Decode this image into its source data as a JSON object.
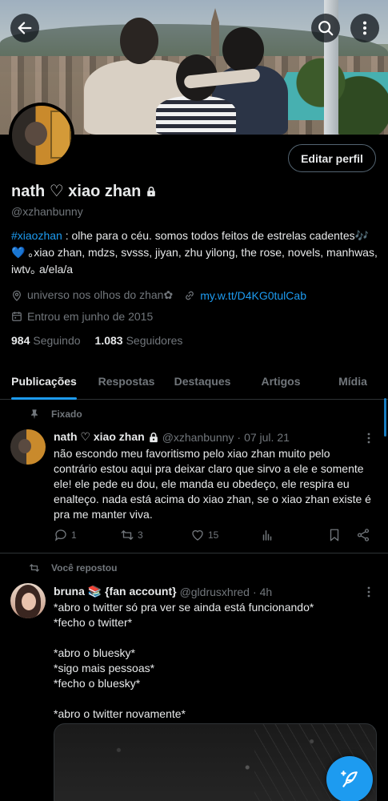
{
  "header": {
    "back_icon": "arrow-left-icon",
    "search_icon": "search-icon",
    "more_icon": "more-vertical-icon"
  },
  "profile": {
    "display_name": "nath ♡ xiao zhan",
    "handle": "@xzhanbunny",
    "edit_button": "Editar perfil",
    "bio_hashtag": "#xiaozhan",
    "bio_text": " : olhe para o céu. somos todos feitos de estrelas cadentes🎶💙 ｡xiao zhan, mdzs, svsss, jiyan, zhu yilong, the rose, novels, manhwas, iwtv｡ a/ela/a",
    "location": "universo nos olhos do zhan✿",
    "link": "my.w.tt/D4KG0tulCab",
    "joined": "Entrou em junho de 2015",
    "following_count": "984",
    "following_label": "Seguindo",
    "followers_count": "1.083",
    "followers_label": "Seguidores"
  },
  "tabs": [
    {
      "label": "Publicações",
      "active": true
    },
    {
      "label": "Respostas",
      "active": false
    },
    {
      "label": "Destaques",
      "active": false
    },
    {
      "label": "Artigos",
      "active": false
    },
    {
      "label": "Mídia",
      "active": false
    }
  ],
  "tweets": [
    {
      "context": "Fixado",
      "display_name": "nath ♡ xiao zhan",
      "handle": "@xzhanbunny",
      "sep": "·",
      "time": "07 jul. 21",
      "text": "não escondo meu favoritismo pelo xiao zhan muito pelo contrário estou aqui pra deixar claro que sirvo a ele e somente ele! ele pede eu dou, ele manda eu obedeço, ele respira eu enalteço. nada está acima do xiao zhan, se o xiao zhan existe é pra me manter viva.",
      "replies": "1",
      "retweets": "3",
      "likes": "15"
    },
    {
      "context": "Você repostou",
      "display_name": "bruna 📚 {fan account}",
      "handle": "@gldrusxhred",
      "sep": "·",
      "time": "4h",
      "text": "*abro o twitter só pra ver se ainda está funcionando*\n*fecho o twitter*\n\n*abro o bluesky*\n*sigo mais pessoas*\n*fecho o bluesky*\n\n*abro o twitter novamente*"
    }
  ],
  "colors": {
    "accent": "#1d9bf0",
    "background": "#000000",
    "text_primary": "#e7e9ea",
    "text_secondary": "#71767b",
    "divider": "#2f3336"
  },
  "compose_icon": "compose-feather-icon"
}
